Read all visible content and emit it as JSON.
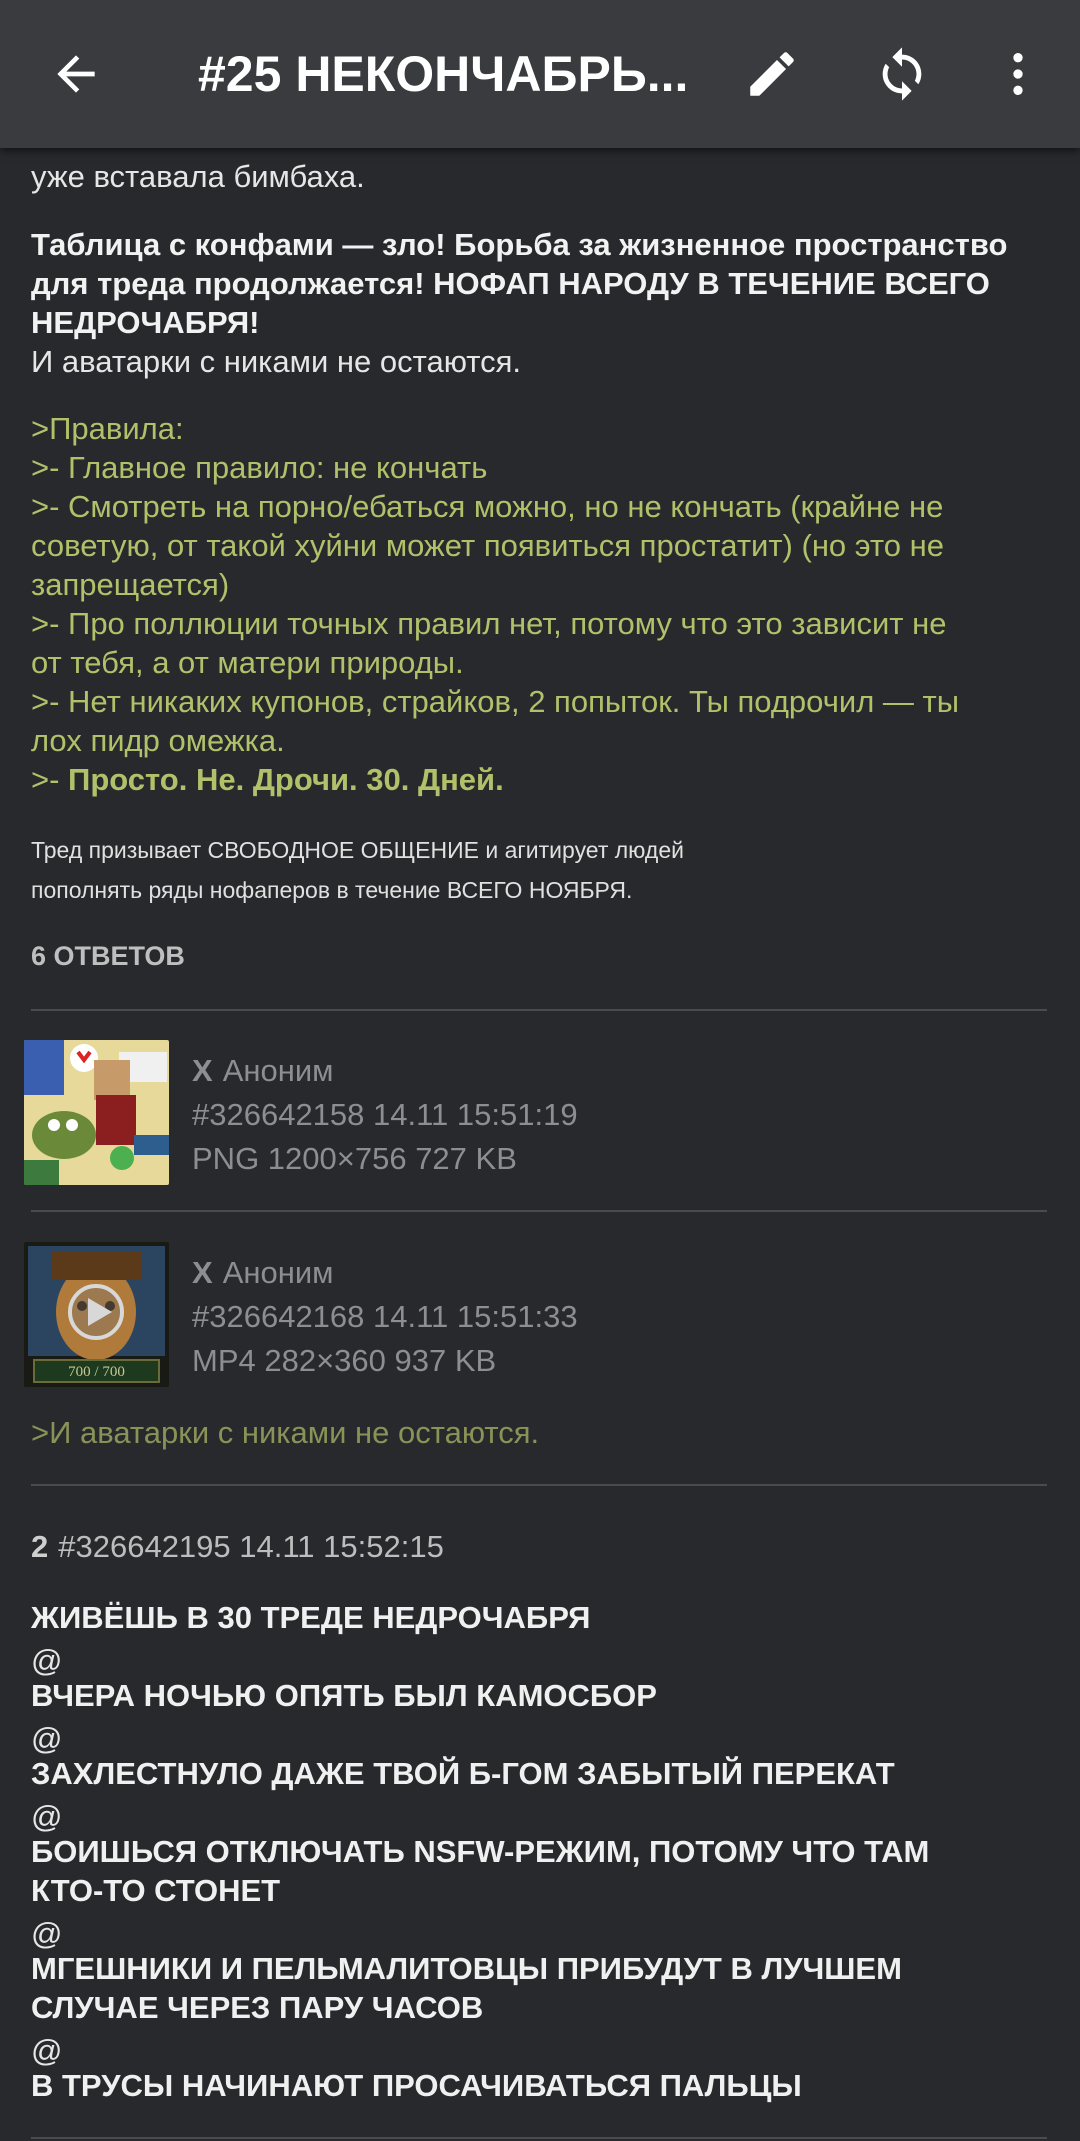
{
  "app_bar": {
    "title": "#25 НЕКОНЧАБРЬ...",
    "back_icon": "arrow-left-icon",
    "edit_icon": "pencil-icon",
    "refresh_icon": "refresh-icon",
    "menu_icon": "more-vert-icon"
  },
  "op": {
    "partial_line": "уже вставала бимбаха.",
    "bold_para": [
      "Таблица с конфами — зло! Борьба за жизненное пространство",
      "для треда продолжается! НОФАП НАРОДУ В ТЕЧЕНИЕ ВСЕГО",
      "НЕДРОЧАБРЯ!"
    ],
    "plain_line": "И аватарки с никами не остаются.",
    "rules": [
      ">Правила:",
      ">- Главное правило: не кончать",
      ">- Смотреть на порно/ебаться можно, но не кончать (крайне не",
      "советую, от такой хуйни может появиться простатит) (но это не",
      "запрещается)",
      ">- Про поллюции точных правил нет, потому что это зависит не",
      "от тебя, а от матери природы.",
      ">- Нет никаких купонов, страйков, 2 попыток. Ты подрочил — ты",
      "лох пидр омежка."
    ],
    "rule_last_prefix": ">- ",
    "rule_last_bold": "Просто. Не. Дрочи. 30. Дней.",
    "footer_lines": [
      "Тред призывает СВОБОДНОЕ ОБЩЕНИЕ и агитирует людей",
      "пополнять ряды нофаперов в течение ВСЕГО НОЯБРЯ."
    ],
    "replies_count": "6 ОТВЕТОВ"
  },
  "posts": [
    {
      "marker": "X",
      "name": "Аноним",
      "id_time": "#326642158 14.11 15:51:19",
      "file": "PNG 1200×756 727 KB"
    },
    {
      "marker": "X",
      "name": "Аноним",
      "id_time": "#326642168 14.11 15:51:33",
      "file": "MP4 282×360 937 KB",
      "thumb_caption": "700 / 700",
      "quote": ">И аватарки с никами не остаются."
    }
  ],
  "post3": {
    "num": "2",
    "id_time": "#326642195 14.11 15:52:15",
    "lines": [
      "ЖИВЁШЬ В 30 ТРЕДЕ НЕДРОЧАБРЯ",
      "@",
      "ВЧЕРА НОЧЬЮ ОПЯТЬ БЫЛ КАМОСБОР",
      "@",
      "ЗАХЛЕСТНУЛО ДАЖЕ ТВОЙ Б-ГОМ ЗАБЫТЫЙ ПЕРЕКАТ",
      "@",
      "БОИШЬСЯ ОТКЛЮЧАТЬ NSFW-РЕЖИМ, ПОТОМУ ЧТО ТАМ",
      "КТО-ТО СТОНЕТ",
      "@",
      "МГЕШНИКИ И ПЕЛЬМАЛИТОВЦЫ ПРИБУДУТ В ЛУЧШЕМ",
      "СЛУЧАЕ ЧЕРЕЗ ПАРУ ЧАСОВ",
      "@",
      "В ТРУСЫ НАЧИНАЮТ ПРОСАЧИВАТЬСЯ ПАЛЬЦЫ"
    ]
  },
  "colors": {
    "background": "#28292d",
    "appbar": "#3a3b3f",
    "greentext": "#b3c06a",
    "meta": "#8d8e92"
  }
}
